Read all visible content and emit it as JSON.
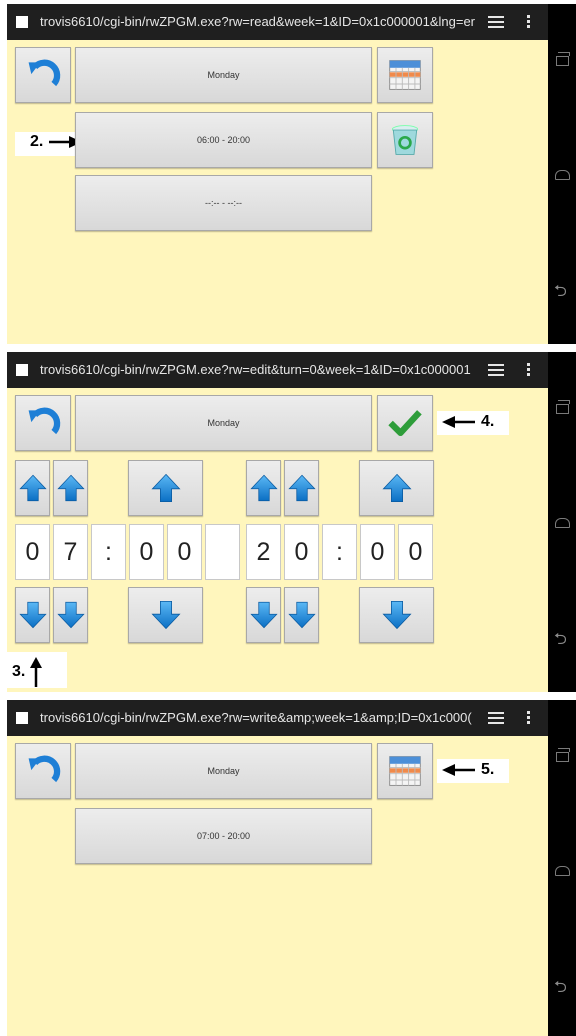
{
  "screens": [
    {
      "url": "trovis6610/cgi-bin/rwZPGM.exe?rw=read&week=1&ID=0x1c000001&lng=er",
      "day": "Monday",
      "time_slot_1": "06:00 - 20:00",
      "time_slot_2": "--:-- - --:--",
      "callout": "2."
    },
    {
      "url": "trovis6610/cgi-bin/rwZPGM.exe?rw=edit&turn=0&week=1&ID=0x1c000001",
      "day": "Monday",
      "digits": {
        "start_h1": "0",
        "start_h2": "7",
        "colon1": ":",
        "start_m1": "0",
        "start_m2": "0",
        "end_h1": "2",
        "end_h2": "0",
        "colon2": ":",
        "end_m1": "0",
        "end_m2": "0"
      },
      "callout_confirm": "4.",
      "callout_down": "3."
    },
    {
      "url": "trovis6610/cgi-bin/rwZPGM.exe?rw=write&amp;week=1&amp;ID=0x1c000(",
      "day": "Monday",
      "time_slot_1": "07:00 - 20:00",
      "callout": "5."
    }
  ],
  "colors": {
    "panel_bg": "#fff6bd",
    "arrow_blue": "#1e88e5",
    "check_green": "#2e9d3a"
  },
  "icons": [
    "undo-icon",
    "calendar-icon",
    "recycle-bin-icon",
    "arrow-up-icon",
    "arrow-down-icon",
    "checkmark-icon",
    "nav-recent-apps-icon",
    "nav-home-icon",
    "nav-back-icon",
    "browser-menu-icon",
    "browser-overflow-icon"
  ]
}
